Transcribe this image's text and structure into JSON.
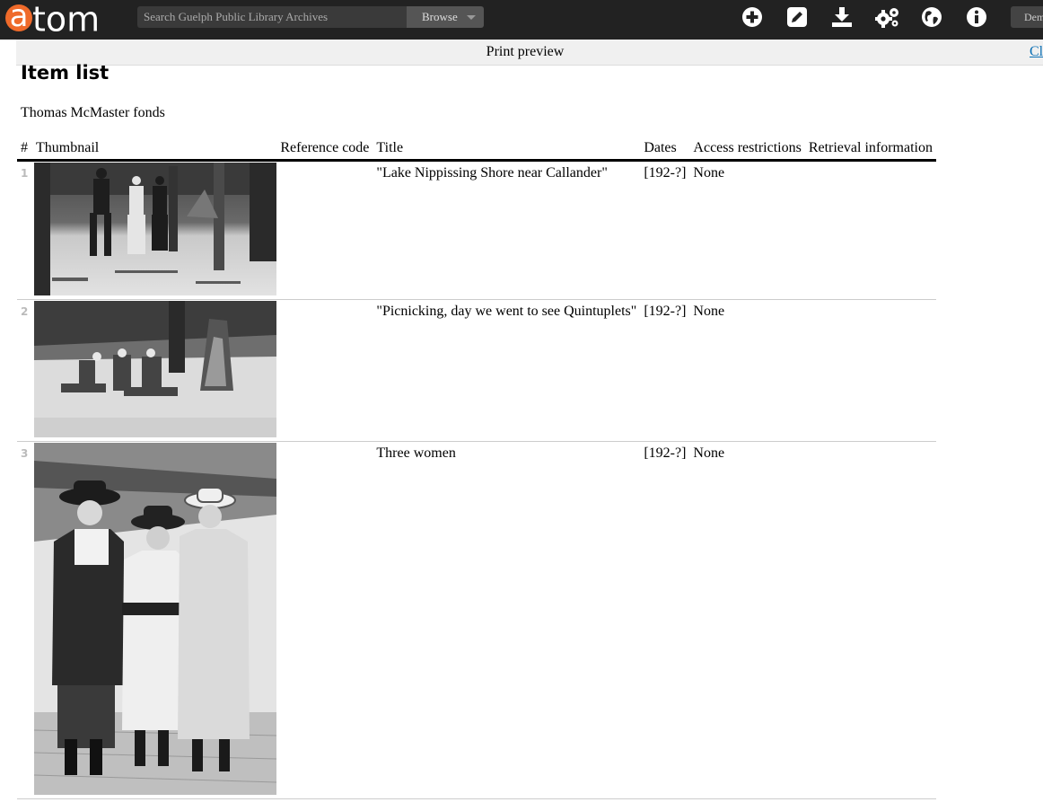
{
  "header": {
    "logo_letter": "a",
    "logo_rest": "tom",
    "search_placeholder": "Search Guelph Public Library Archives",
    "browse_label": "Browse",
    "user_label": "Demo",
    "icons": [
      "add-icon",
      "edit-icon",
      "import-icon",
      "settings-icon",
      "language-icon",
      "info-icon"
    ]
  },
  "print_bar": {
    "label": "Print preview",
    "close_label": "Close"
  },
  "page": {
    "title": "Item list",
    "fonds": "Thomas McMaster fonds"
  },
  "table": {
    "headers": [
      "#",
      "Thumbnail",
      "Reference code",
      "Title",
      "Dates",
      "Access restrictions",
      "Retrieval information"
    ],
    "rows": [
      {
        "num": "1",
        "reference_code": "",
        "title": "\"Lake Nippissing Shore near Callander\"",
        "dates": "[192-?]",
        "access": "None",
        "retrieval": ""
      },
      {
        "num": "2",
        "reference_code": "",
        "title": "\"Picnicking, day we went to see Quintuplets\"",
        "dates": "[192-?]",
        "access": "None",
        "retrieval": ""
      },
      {
        "num": "3",
        "reference_code": "",
        "title": "Three women",
        "dates": "[192-?]",
        "access": "None",
        "retrieval": ""
      }
    ]
  },
  "colors": {
    "topbar": "#222222",
    "logo_accent": "#ef6a2a",
    "link": "#0a6fb5"
  }
}
